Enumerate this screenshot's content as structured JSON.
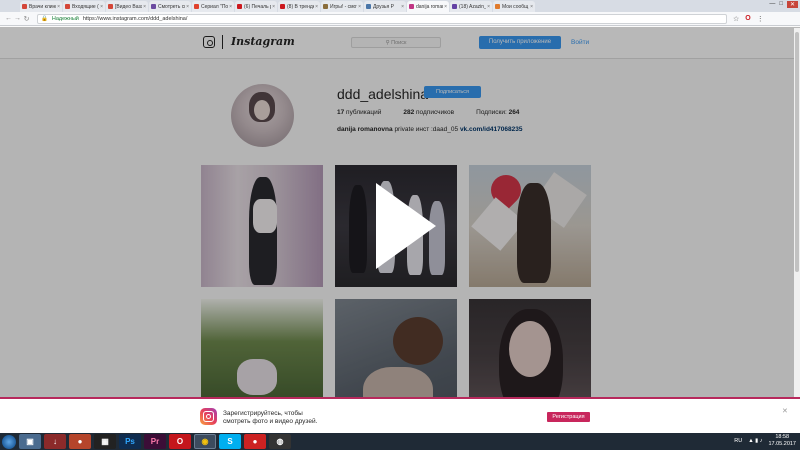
{
  "browser": {
    "tabs": [
      {
        "label": "Врачи клинк",
        "color": "#d44638"
      },
      {
        "label": "Входящие (1",
        "color": "#d44638"
      },
      {
        "label": "[Видео Вазз",
        "color": "#d44638"
      },
      {
        "label": "Смотреть сп",
        "color": "#6b4aa0"
      },
      {
        "label": "Сериал \"Пос",
        "color": "#e0412c"
      },
      {
        "label": "(6) Печаль р",
        "color": "#cc181e"
      },
      {
        "label": "(8) В тренде",
        "color": "#cc181e"
      },
      {
        "label": "Игры! - смот",
        "color": "#8a6d3b"
      },
      {
        "label": "Друзья Р",
        "color": "#4a76a8"
      },
      {
        "label": "danija romar",
        "color": "#c13584"
      },
      {
        "label": "(18) Azazin_f",
        "color": "#6441a4"
      },
      {
        "label": "Мои сообщ",
        "color": "#e07a2c"
      }
    ],
    "active_tab_index": 9,
    "secure_label": "Надежный",
    "url": "https://www.instagram.com/ddd_adelshina/"
  },
  "header": {
    "wordmark": "Instagram",
    "search_placeholder": "Поиск",
    "get_app_label": "Получить приложение",
    "login_label": "Войти"
  },
  "profile": {
    "username": "ddd_adelshina",
    "follow_label": "Подписаться",
    "posts_count": "17",
    "posts_label": "публикаций",
    "followers_count": "282",
    "followers_label": "подписчиков",
    "following_label": "Подписки:",
    "following_count": "264",
    "full_name": "danija romanovna",
    "bio_text": "private инст :daad_05",
    "bio_link": "vk.com/id417068235"
  },
  "banner": {
    "line1": "Зарегистрируйтесь, чтобы",
    "line2": "смотреть фото и видео друзей.",
    "register_label": "Регистрация",
    "close_glyph": "✕"
  },
  "taskbar": {
    "lang": "RU",
    "time": "18:58",
    "date": "17.05.2017"
  }
}
